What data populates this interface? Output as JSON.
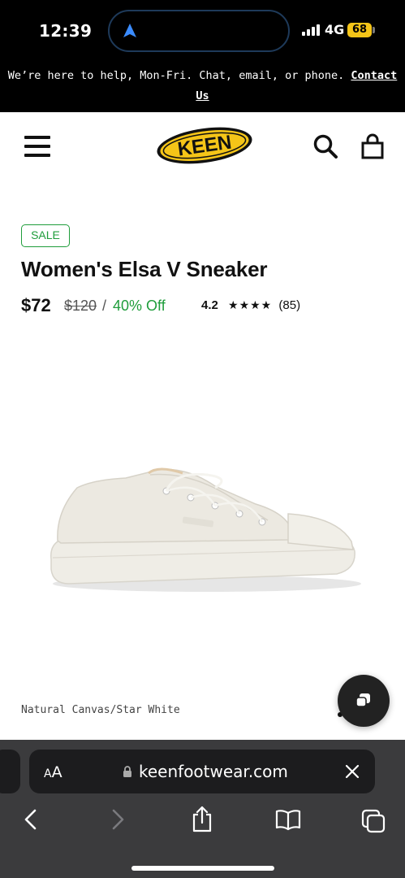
{
  "status_bar": {
    "time": "12:39",
    "network": "4G",
    "battery": "68"
  },
  "announcement": {
    "text": "We’re here to help, Mon-Fri. Chat, email, or phone.",
    "link_label": "Contact Us"
  },
  "header": {
    "logo_text": "KEEN",
    "icons": [
      "menu-icon",
      "search-icon",
      "bag-icon"
    ]
  },
  "product": {
    "badge": "SALE",
    "title": "Women's Elsa V Sneaker",
    "price": "$72",
    "original_price": "$120",
    "separator": "/",
    "discount": "40% Off",
    "rating": "4.2",
    "stars": "★★★★",
    "review_count": "(85)",
    "color_name": "Natural Canvas/Star White"
  },
  "browser": {
    "aa_label_small": "A",
    "aa_label_large": "A",
    "url": "keenfootwear.com",
    "toolbar_icons": [
      "back-icon",
      "forward-icon",
      "share-icon",
      "bookmarks-icon",
      "tabs-icon"
    ]
  },
  "colors": {
    "accent_green": "#1f9d3b",
    "keen_yellow": "#f5c518",
    "chrome_dark": "#3b3b3d"
  }
}
